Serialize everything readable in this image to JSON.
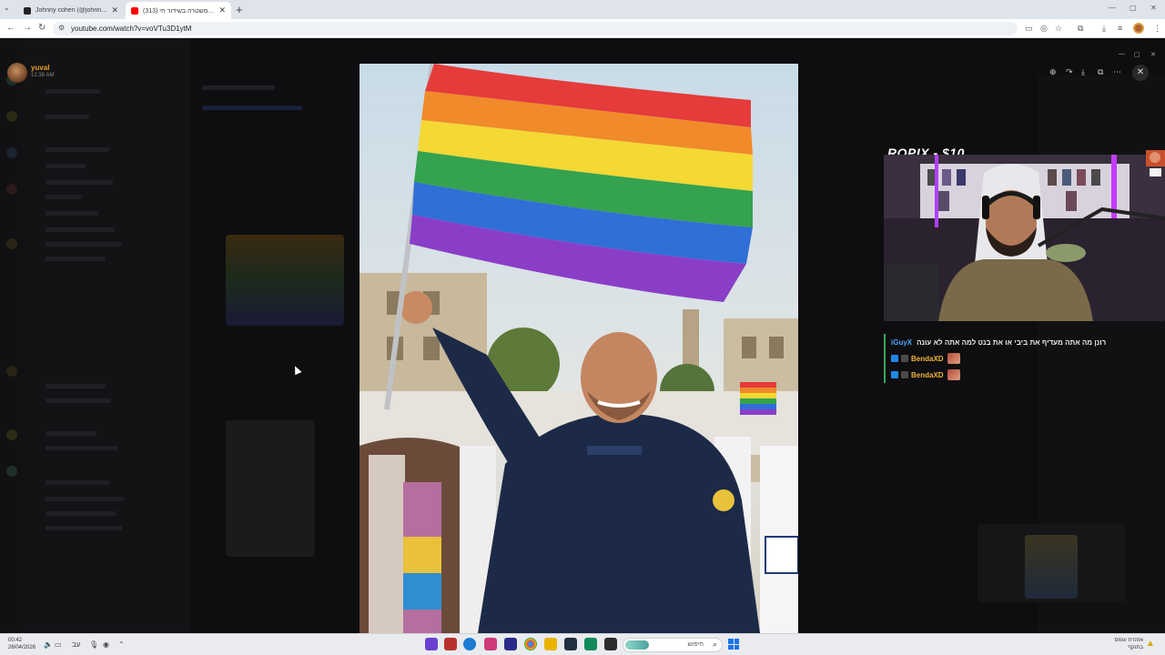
{
  "browser": {
    "tabs": [
      {
        "title": "Johnny cohen (@johnny_cohen",
        "active": false,
        "favicon_color": "#222222"
      },
      {
        "title": "(313) קבוצת משטרה בשידור חי 🔴",
        "active": true,
        "favicon_color": "#ff0000"
      }
    ],
    "new_tab_label": "+",
    "url": "youtube.com/watch?v=voVTu3D1ytM",
    "window_controls": [
      "—",
      "▢",
      "✕"
    ]
  },
  "viewer": {
    "user": "yuval",
    "time": "12:38 AM",
    "tool_icons": [
      "zoom-in-icon",
      "rotate-icon",
      "download-icon",
      "open-external-icon",
      "more-icon"
    ],
    "close_label": "✕"
  },
  "stream": {
    "donation_text": "ROPIX - $10",
    "chat": [
      {
        "user": "iGuyX",
        "text": "רונן מה אתה מעדיף את ביבי או את בנט למה אתה לא עונה",
        "user_color": "#4da3ff"
      },
      {
        "user": "BendaXD",
        "text": "",
        "user_color": "#f0b33a"
      },
      {
        "user": "BendaXD",
        "text": "",
        "user_color": "#f0b33a"
      }
    ]
  },
  "taskbar": {
    "time": "00:42",
    "date": "26/04/2026",
    "lang": "עב",
    "search_label": "חיפוש",
    "weather_line1": "אזהרת עומס",
    "weather_line2": "בתוקף",
    "app_colors": [
      "#6a3fd1",
      "#b8322b",
      "#1b7bd1",
      "#cf3a7a",
      "#2a2a8a",
      "#1a73e8",
      "#203040",
      "#118a5a",
      "#e8b400",
      "#2b2b2b"
    ]
  },
  "colors": {
    "accent_username": "#f0a020",
    "chat_border": "#3ba55d"
  }
}
